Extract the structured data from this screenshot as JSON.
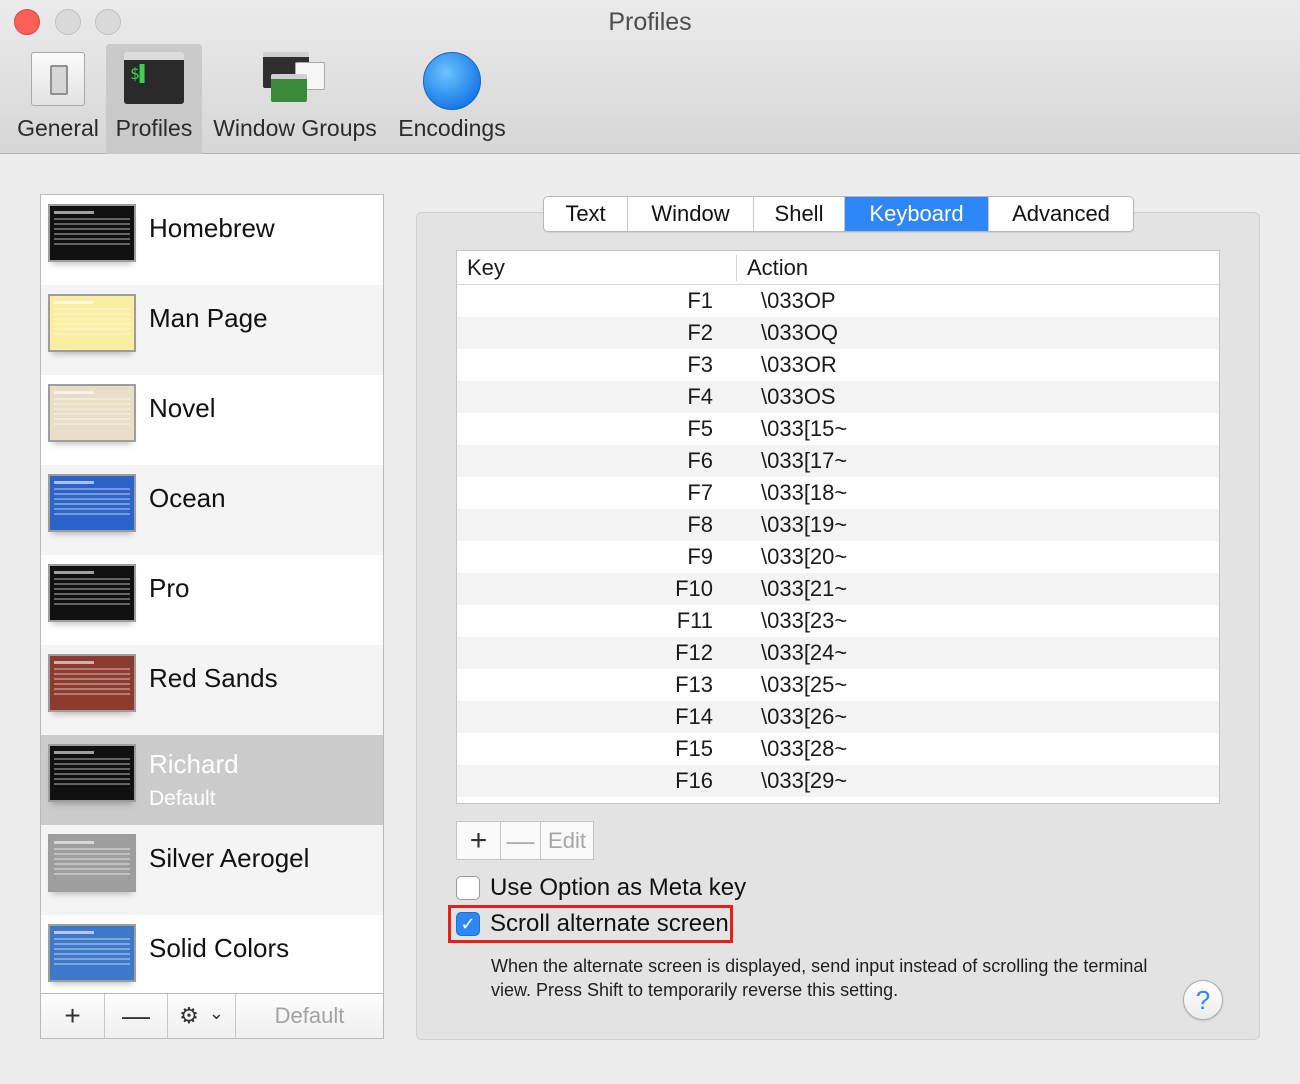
{
  "window": {
    "title": "Profiles"
  },
  "toolbar": {
    "items": [
      {
        "label": "General",
        "icon": "general-switch-icon"
      },
      {
        "label": "Profiles",
        "icon": "terminal-icon",
        "active": true
      },
      {
        "label": "Window Groups",
        "icon": "window-groups-icon"
      },
      {
        "label": "Encodings",
        "icon": "globe-icon"
      }
    ]
  },
  "profiles": {
    "items": [
      {
        "name": "Homebrew",
        "thumb_bg": "#111111",
        "thumb_fg": "#2ee62e"
      },
      {
        "name": "Man Page",
        "thumb_bg": "#fbeea0",
        "thumb_fg": "#333333"
      },
      {
        "name": "Novel",
        "thumb_bg": "#e8dec7",
        "thumb_fg": "#6b3a2a"
      },
      {
        "name": "Ocean",
        "thumb_bg": "#2b63c9",
        "thumb_fg": "#ffffff"
      },
      {
        "name": "Pro",
        "thumb_bg": "#111111",
        "thumb_fg": "#dddddd"
      },
      {
        "name": "Red Sands",
        "thumb_bg": "#8c3b2e",
        "thumb_fg": "#f0d6b0"
      },
      {
        "name": "Richard",
        "sub": "Default",
        "selected": true,
        "thumb_bg": "#111111",
        "thumb_fg": "#ffffff"
      },
      {
        "name": "Silver Aerogel",
        "thumb_bg": "#9e9e9e",
        "thumb_fg": "#1f1f1f"
      },
      {
        "name": "Solid Colors",
        "thumb_bg": "#3d78c9",
        "thumb_fg": "#ffffff"
      }
    ],
    "bar": {
      "add": "+",
      "remove": "—",
      "gear": "⚙",
      "chevron": "⌄",
      "default_label": "Default"
    }
  },
  "tabs": [
    {
      "label": "Text"
    },
    {
      "label": "Window"
    },
    {
      "label": "Shell"
    },
    {
      "label": "Keyboard",
      "active": true
    },
    {
      "label": "Advanced"
    }
  ],
  "keyboard_table": {
    "headers": {
      "key": "Key",
      "action": "Action"
    },
    "rows": [
      {
        "key": "F1",
        "action": "\\033OP"
      },
      {
        "key": "F2",
        "action": "\\033OQ"
      },
      {
        "key": "F3",
        "action": "\\033OR"
      },
      {
        "key": "F4",
        "action": "\\033OS"
      },
      {
        "key": "F5",
        "action": "\\033[15~"
      },
      {
        "key": "F6",
        "action": "\\033[17~"
      },
      {
        "key": "F7",
        "action": "\\033[18~"
      },
      {
        "key": "F8",
        "action": "\\033[19~"
      },
      {
        "key": "F9",
        "action": "\\033[20~"
      },
      {
        "key": "F10",
        "action": "\\033[21~"
      },
      {
        "key": "F11",
        "action": "\\033[23~"
      },
      {
        "key": "F12",
        "action": "\\033[24~"
      },
      {
        "key": "F13",
        "action": "\\033[25~"
      },
      {
        "key": "F14",
        "action": "\\033[26~"
      },
      {
        "key": "F15",
        "action": "\\033[28~"
      },
      {
        "key": "F16",
        "action": "\\033[29~"
      }
    ]
  },
  "table_bar": {
    "add": "+",
    "remove": "—",
    "edit": "Edit"
  },
  "options": {
    "meta_key": {
      "label": "Use Option as Meta key",
      "checked": false
    },
    "scroll_alt": {
      "label": "Scroll alternate screen",
      "checked": true,
      "check_glyph": "✓"
    },
    "description": "When the alternate screen is displayed, send input instead of scrolling the terminal view. Press Shift to temporarily reverse this setting."
  },
  "help": {
    "label": "?"
  },
  "colors": {
    "accent": "#2f86f6",
    "highlight_border": "#e8201c",
    "close": "#fc5f57"
  }
}
